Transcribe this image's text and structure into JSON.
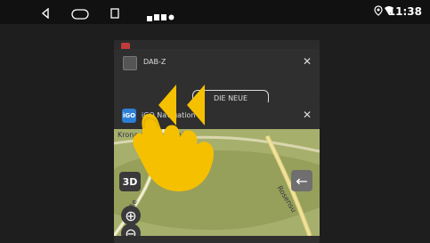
{
  "status_bar": {
    "clock": "11:38",
    "nav_icons": [
      "back-icon",
      "home-icon",
      "recents-icon"
    ],
    "right_icons": [
      "location-icon",
      "wifi-icon"
    ],
    "notification_icons": [
      "notification-icon-1",
      "notification-icon-2",
      "notification-icon-3",
      "notification-icon-4"
    ]
  },
  "recents": {
    "cards": [
      {
        "title": "DAB-Z",
        "close_label": "✕"
      },
      {
        "title": "iGO Navigation",
        "close_label": "✕"
      }
    ],
    "button_text_partial": "DIE NEUE",
    "map": {
      "street_label_top": "Kronau (Karlsruhe)",
      "street_label_right": "Rosensu",
      "street_label_left": "traße",
      "button_3d": "3D"
    }
  },
  "overlay": {
    "gesture_hint": "swipe-left hint with hand pointer"
  },
  "colors": {
    "accent_yellow": "#f5c000",
    "map_green": "#9aa35c",
    "header_gray": "#2f2f2f"
  }
}
